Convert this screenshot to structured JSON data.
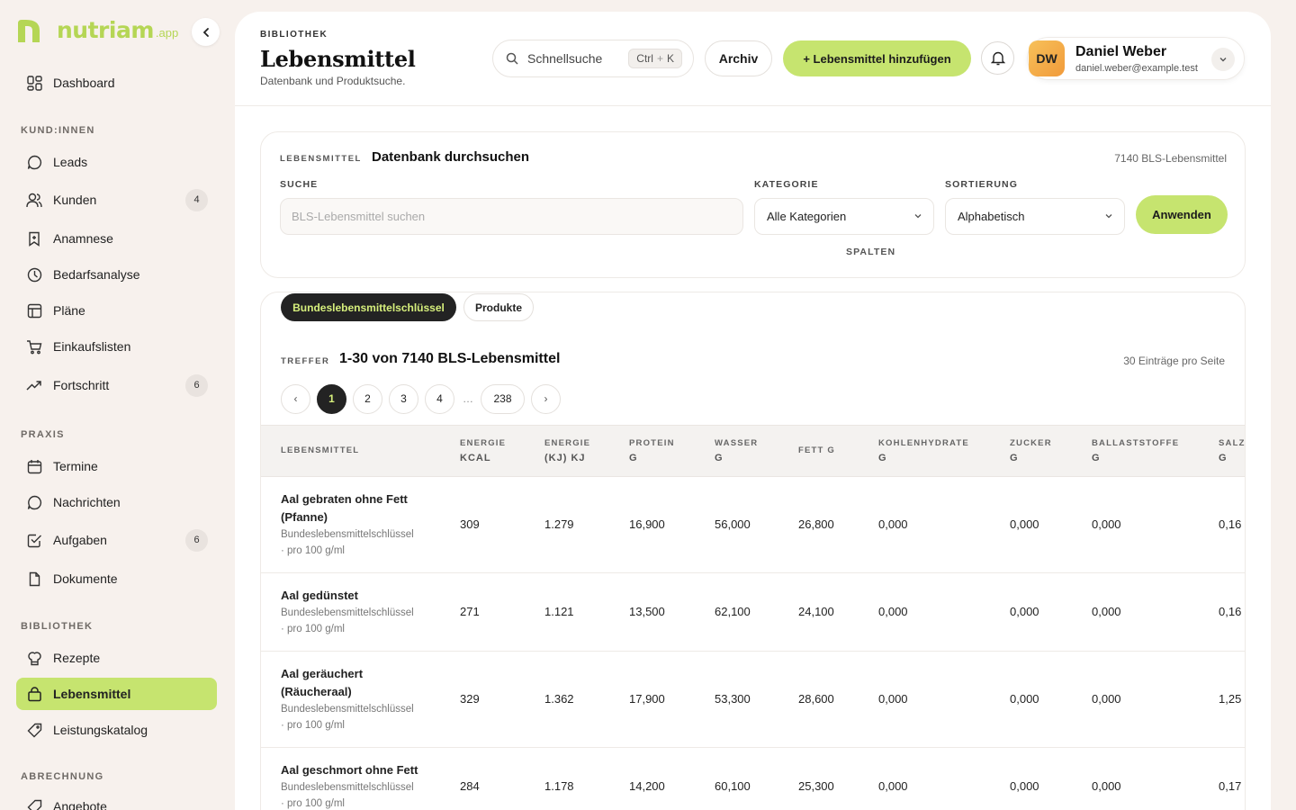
{
  "brand": {
    "name": "nutriam",
    "suffix": ".app"
  },
  "sidebar": {
    "dashboard": "Dashboard",
    "sections": {
      "kunden": "KUND:INNEN",
      "praxis": "PRAXIS",
      "bibliothek": "BIBLIOTHEK",
      "abrechnung": "ABRECHNUNG"
    },
    "items": {
      "leads": "Leads",
      "kunden": "Kunden",
      "kunden_badge": "4",
      "anamnese": "Anamnese",
      "bedarfsanalyse": "Bedarfsanalyse",
      "plaene": "Pläne",
      "einkaufslisten": "Einkaufslisten",
      "fortschritt": "Fortschritt",
      "fortschritt_badge": "6",
      "termine": "Termine",
      "nachrichten": "Nachrichten",
      "aufgaben": "Aufgaben",
      "aufgaben_badge": "6",
      "dokumente": "Dokumente",
      "rezepte": "Rezepte",
      "lebensmittel": "Lebensmittel",
      "leistungskatalog": "Leistungskatalog",
      "angebote": "Angebote"
    }
  },
  "header": {
    "eyebrow": "BIBLIOTHEK",
    "title": "Lebensmittel",
    "subtitle": "Datenbank und Produktsuche.",
    "quicksearch": "Schnellsuche",
    "kbd_ctrl": "Ctrl",
    "kbd_plus": "+",
    "kbd_key": "K",
    "archiv": "Archiv",
    "add": "+ Lebensmittel hinzufügen"
  },
  "user": {
    "initials": "DW",
    "name": "Daniel Weber",
    "email": "daniel.weber@example.test"
  },
  "search": {
    "eyebrow": "LEBENSMITTEL",
    "title": "Datenbank durchsuchen",
    "count": "7140 BLS-Lebensmittel",
    "suche_label": "SUCHE",
    "suche_placeholder": "BLS-Lebensmittel suchen",
    "kategorie_label": "KATEGORIE",
    "kategorie_value": "Alle Kategorien",
    "sortierung_label": "SORTIERUNG",
    "sortierung_value": "Alphabetisch",
    "apply": "Anwenden",
    "spalten": "SPALTEN"
  },
  "results": {
    "tabs": [
      "Bundeslebensmittelschlüssel",
      "Produkte"
    ],
    "eyebrow": "TREFFER",
    "title": "1-30 von 7140 BLS-Lebensmittel",
    "per_page": "30 Einträge pro Seite",
    "pages": [
      "‹",
      "1",
      "2",
      "3",
      "4",
      "…",
      "238",
      "›"
    ],
    "columns": [
      {
        "top": "LEBENSMITTEL",
        "unit": ""
      },
      {
        "top": "ENERGIE",
        "unit": "KCAL"
      },
      {
        "top": "ENERGIE",
        "unit": "(KJ) KJ"
      },
      {
        "top": "PROTEIN",
        "unit": "G"
      },
      {
        "top": "WASSER",
        "unit": "G"
      },
      {
        "top": "FETT G",
        "unit": ""
      },
      {
        "top": "KOHLENHYDRATE",
        "unit": "G"
      },
      {
        "top": "ZUCKER",
        "unit": "G"
      },
      {
        "top": "BALLASTSTOFFE",
        "unit": "G"
      },
      {
        "top": "SALZ",
        "unit": "G"
      }
    ],
    "rows": [
      {
        "name1": "Aal gebraten ohne Fett",
        "name2": "(Pfanne)",
        "source": "Bundeslebensmittelschlüssel",
        "per": "· pro 100 g/ml",
        "values": [
          "309",
          "1.279",
          "16,900",
          "56,000",
          "26,800",
          "0,000",
          "0,000",
          "0,000",
          "0,16"
        ]
      },
      {
        "name1": "Aal gedünstet",
        "name2": "",
        "source": "Bundeslebensmittelschlüssel",
        "per": "· pro 100 g/ml",
        "values": [
          "271",
          "1.121",
          "13,500",
          "62,100",
          "24,100",
          "0,000",
          "0,000",
          "0,000",
          "0,16"
        ]
      },
      {
        "name1": "Aal geräuchert",
        "name2": "(Räucheraal)",
        "source": "Bundeslebensmittelschlüssel",
        "per": "· pro 100 g/ml",
        "values": [
          "329",
          "1.362",
          "17,900",
          "53,300",
          "28,600",
          "0,000",
          "0,000",
          "0,000",
          "1,25"
        ]
      },
      {
        "name1": "Aal geschmort ohne Fett",
        "name2": "",
        "source": "Bundeslebensmittelschlüssel",
        "per": "· pro 100 g/ml",
        "values": [
          "284",
          "1.178",
          "14,200",
          "60,100",
          "25,300",
          "0,000",
          "0,000",
          "0,000",
          "0,17"
        ]
      }
    ]
  },
  "colors": {
    "accent": "#c6e46f",
    "dark": "#232323",
    "bg": "#f7f1ed"
  }
}
